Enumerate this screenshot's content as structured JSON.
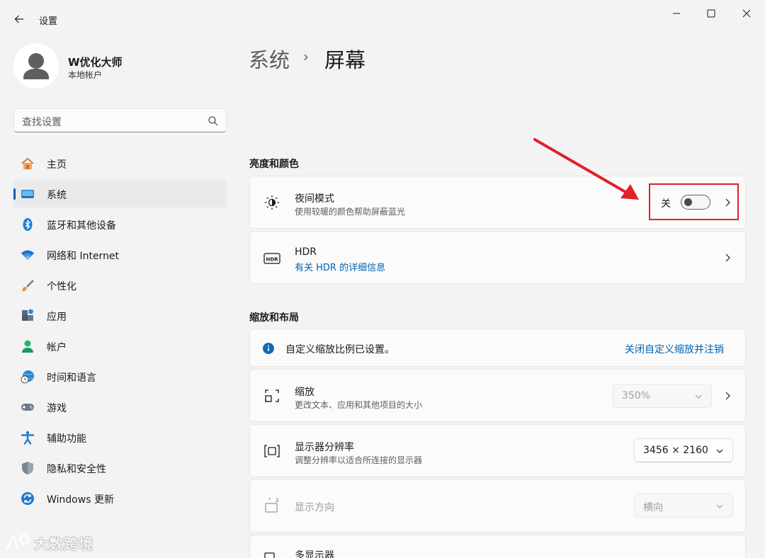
{
  "titlebar": {
    "title": "设置"
  },
  "profile": {
    "name": "W优化大师",
    "account_type": "本地帐户"
  },
  "search": {
    "placeholder": "查找设置"
  },
  "nav": {
    "items": [
      {
        "label": "主页",
        "icon": "home-icon"
      },
      {
        "label": "系统",
        "icon": "system-icon",
        "active": true
      },
      {
        "label": "蓝牙和其他设备",
        "icon": "bluetooth-icon"
      },
      {
        "label": "网络和 Internet",
        "icon": "wifi-icon"
      },
      {
        "label": "个性化",
        "icon": "brush-icon"
      },
      {
        "label": "应用",
        "icon": "apps-icon"
      },
      {
        "label": "帐户",
        "icon": "account-icon"
      },
      {
        "label": "时间和语言",
        "icon": "globe-clock-icon"
      },
      {
        "label": "游戏",
        "icon": "gamepad-icon"
      },
      {
        "label": "辅助功能",
        "icon": "accessibility-icon"
      },
      {
        "label": "隐私和安全性",
        "icon": "shield-icon"
      },
      {
        "label": "Windows 更新",
        "icon": "update-icon"
      }
    ]
  },
  "breadcrumb": {
    "parent": "系统",
    "separator": "›",
    "current": "屏幕"
  },
  "brightness_section": {
    "title": "亮度和颜色",
    "night_light": {
      "title": "夜间模式",
      "subtitle": "使用较暖的颜色帮助屏蔽蓝光",
      "state_label": "关",
      "on": false
    },
    "hdr": {
      "title": "HDR",
      "link": "有关 HDR 的详细信息"
    }
  },
  "scale_section": {
    "title": "缩放和布局",
    "info_banner": {
      "text": "自定义缩放比例已设置。",
      "action": "关闭自定义缩放并注销"
    },
    "scale": {
      "title": "缩放",
      "subtitle": "更改文本、应用和其他项目的大小",
      "value": "350%"
    },
    "resolution": {
      "title": "显示器分辨率",
      "subtitle": "调整分辨率以适合所连接的显示器",
      "value": "3456 × 2160"
    },
    "orientation": {
      "title": "显示方向",
      "value": "横向"
    },
    "multi_display": {
      "title": "多显示器"
    }
  },
  "watermark": {
    "text": "大数跨境"
  },
  "colors": {
    "accent": "#005fb8",
    "highlight": "#e0202a",
    "link": "#0062b0"
  }
}
